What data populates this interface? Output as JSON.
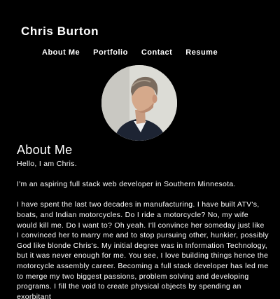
{
  "header": {
    "title": "Chris Burton"
  },
  "nav": {
    "items": [
      {
        "label": "About Me"
      },
      {
        "label": "Portfolio"
      },
      {
        "label": "Contact"
      },
      {
        "label": "Resume"
      }
    ]
  },
  "profile": {
    "photo_description": "profile-photo"
  },
  "about": {
    "heading": "About Me",
    "greeting": "Hello, I am Chris.",
    "paragraph_1": "I'm an aspiring full stack web developer in Southern Minnesota.",
    "paragraph_2": "I have spent the last two decades in manufacturing. I have built ATV's, boats, and Indian motorcycles. Do I ride a motorcycle? No, my wife would kill me. Do I want to? Oh yeah. I'll convince her someday just like I convinced her to marry me and to stop pursuing other, hunkier, possibly God like blonde Chris's. My initial degree was in Information Technology, but it was never enough for me. You see, I love building things hence the motorcycle assembly career. Becoming a full stack developer has led me to merge my two biggest passions, problem solving and developing programs. I fill the void to create physical objects by spending an exorbitant"
  },
  "colors": {
    "background": "#000000",
    "text": "#ffffff"
  }
}
